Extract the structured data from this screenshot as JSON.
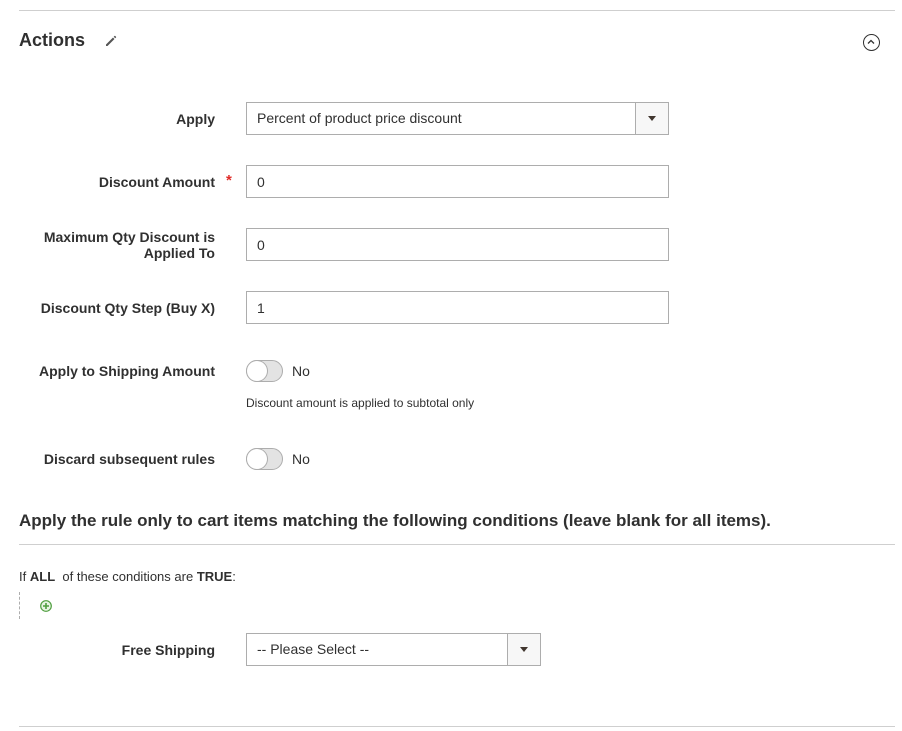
{
  "section": {
    "title": "Actions"
  },
  "form": {
    "apply": {
      "label": "Apply",
      "value": "Percent of product price discount"
    },
    "discount_amount": {
      "label": "Discount Amount",
      "required_mark": "*",
      "value": "0"
    },
    "max_qty": {
      "label_line1": "Maximum Qty Discount is",
      "label_line2": "Applied To",
      "value": "0"
    },
    "qty_step": {
      "label": "Discount Qty Step (Buy X)",
      "value": "1"
    },
    "apply_shipping": {
      "label": "Apply to Shipping Amount",
      "state": "No",
      "note": "Discount amount is applied to subtotal only"
    },
    "discard_rules": {
      "label": "Discard subsequent rules",
      "state": "No"
    },
    "free_shipping": {
      "label": "Free Shipping",
      "value": "-- Please Select --"
    }
  },
  "conditions": {
    "title": "Apply the rule only to cart items matching the following conditions (leave blank for all items).",
    "if_word": "If",
    "aggregator": "ALL",
    "middle": "of these conditions are",
    "value": "TRUE",
    "suffix": ":"
  },
  "colors": {
    "required": "#e02b27",
    "add_icon": "#4f9e3f"
  },
  "icons": [
    "pencil-icon",
    "chevron-up-circle-icon",
    "add-condition-icon"
  ]
}
